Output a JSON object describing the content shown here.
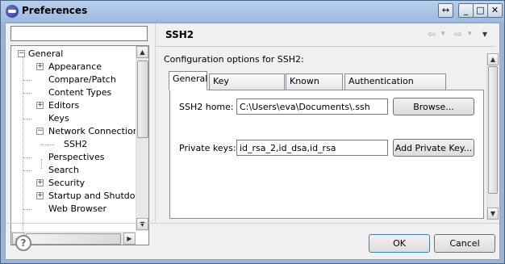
{
  "window": {
    "title": "Preferences",
    "buttons": {
      "restore": "↔",
      "minimize": "_",
      "maximize": "□",
      "close": "✕"
    }
  },
  "filter": {
    "value": "",
    "placeholder": ""
  },
  "tree": {
    "items": [
      {
        "label": "General",
        "expander": "−"
      },
      {
        "label": "Appearance",
        "expander": "+"
      },
      {
        "label": "Compare/Patch",
        "expander": ""
      },
      {
        "label": "Content Types",
        "expander": ""
      },
      {
        "label": "Editors",
        "expander": "+"
      },
      {
        "label": "Keys",
        "expander": ""
      },
      {
        "label": "Network Connections",
        "expander": "−"
      },
      {
        "label": "SSH2",
        "expander": ""
      },
      {
        "label": "Perspectives",
        "expander": ""
      },
      {
        "label": "Search",
        "expander": ""
      },
      {
        "label": "Security",
        "expander": "+"
      },
      {
        "label": "Startup and Shutdown",
        "expander": "+"
      },
      {
        "label": "Web Browser",
        "expander": ""
      }
    ]
  },
  "page": {
    "title": "SSH2",
    "nav": {
      "back": "⇦",
      "back_menu": "▾",
      "forward": "⇨",
      "forward_menu": "▾",
      "view_menu": "▾"
    },
    "config_label": "Configuration options for SSH2:",
    "tabs": [
      {
        "label": "General"
      },
      {
        "label": "Key Management"
      },
      {
        "label": "Known Hosts"
      },
      {
        "label": "Authentication Methods"
      }
    ],
    "ssh2_home_label": "SSH2 home:",
    "ssh2_home_value": "C:\\Users\\eva\\Documents\\.ssh",
    "browse_label": "Browse...",
    "private_keys_label": "Private keys:",
    "private_keys_value": "id_rsa_2,id_dsa,id_rsa",
    "add_private_key_label": "Add Private Key..."
  },
  "footer": {
    "help": "?",
    "ok_label": "OK",
    "cancel_label": "Cancel"
  },
  "scroll": {
    "up": "▲",
    "down": "▼",
    "left": "◀",
    "right": "▶"
  }
}
